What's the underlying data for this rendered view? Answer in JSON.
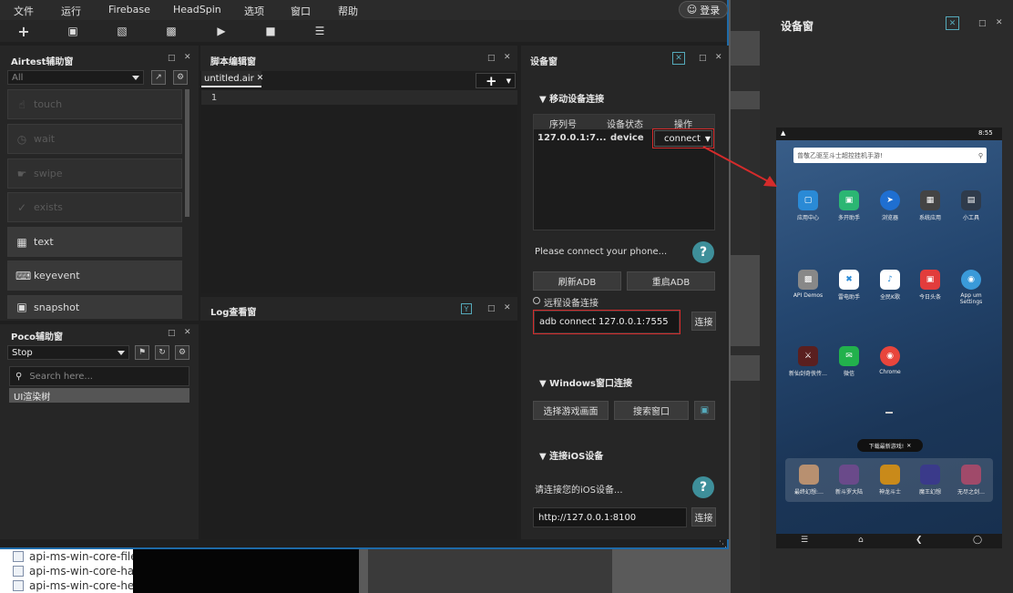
{
  "background": {
    "files": [
      "api-ms-win-core-file",
      "api-ms-win-core-ha",
      "api-ms-win-core-he"
    ]
  },
  "menubar": {
    "items": [
      "文件",
      "运行",
      "Firebase",
      "HeadSpin",
      "选项",
      "窗口",
      "帮助"
    ],
    "login_label": "登录"
  },
  "airtest": {
    "title": "Airtest辅助窗",
    "filter_value": "All",
    "actions": [
      "touch",
      "wait",
      "swipe",
      "exists",
      "text",
      "keyevent",
      "snapshot"
    ]
  },
  "poco": {
    "title": "Poco辅助窗",
    "mode_value": "Stop",
    "search_placeholder": "Search here...",
    "tree_label": "UI渲染树"
  },
  "editor": {
    "title": "脚本编辑窗",
    "tab_label": "untitled.air",
    "line_number": "1",
    "add_label": "+"
  },
  "log": {
    "title": "Log查看窗"
  },
  "device_panel": {
    "title": "设备窗",
    "mobile_section": "▼ 移动设备连接",
    "table_headers": [
      "序列号",
      "设备状态",
      "操作"
    ],
    "device": {
      "serial": "127.0.0.1:7...",
      "status": "device",
      "action": "connect"
    },
    "hint": "Please connect your phone...",
    "refresh_adb": "刷新ADB",
    "restart_adb": "重启ADB",
    "remote_label": "远程设备连接",
    "remote_value": "adb connect 127.0.0.1:7555",
    "connect_label": "连接",
    "windows_section": "▼ Windows窗口连接",
    "select_game": "选择游戏画面",
    "search_window": "搜索窗口",
    "ios_section": "▼ 连接iOS设备",
    "ios_hint": "请连接您的iOS设备...",
    "ios_url": "http://127.0.0.1:8100",
    "ios_connect_label": "连接",
    "help_label": "?"
  },
  "phone_window": {
    "title": "设备窗",
    "time": "8:55",
    "search_placeholder": "曾敬乙驱至斗士超控挂机手游!",
    "apps": [
      {
        "label": "应用中心",
        "icon": "app-center-icon",
        "color": "#2a8ad6"
      },
      {
        "label": "多开助手",
        "icon": "multi-open-icon",
        "color": "#2bb673"
      },
      {
        "label": "浏览器",
        "icon": "browser-icon",
        "color": "#1f6fd1"
      },
      {
        "label": "系统应用",
        "icon": "system-apps-icon",
        "color": "#444444"
      },
      {
        "label": "小工具",
        "icon": "tools-icon",
        "color": "#2f3b4b"
      },
      {
        "label": "API Demos",
        "icon": "api-demos-icon",
        "color": "#888888"
      },
      {
        "label": "雷电助手",
        "icon": "assistant-icon",
        "color": "#ffffff"
      },
      {
        "label": "全民K歌",
        "icon": "karaoke-icon",
        "color": "#ffffff"
      },
      {
        "label": "今日头条",
        "icon": "toutiao-icon",
        "color": "#e23c3c"
      },
      {
        "label": "App um Settings",
        "icon": "settings-app-icon",
        "color": "#3a9ad9"
      },
      {
        "label": "新仙剑奇侠传…",
        "icon": "game-icon",
        "color": "#5a1f1f"
      },
      {
        "label": "微信",
        "icon": "wechat-icon",
        "color": "#22b14c"
      },
      {
        "label": "Chrome",
        "icon": "chrome-icon",
        "color": "#e8453c"
      }
    ],
    "toast": "下载最新游戏!",
    "dock": [
      {
        "label": "最终幻想:…",
        "color": "#b89070"
      },
      {
        "label": "新斗罗大陆",
        "color": "#6a4a8a"
      },
      {
        "label": "神龙斗士",
        "color": "#c98a1a"
      },
      {
        "label": "魔王幻想",
        "color": "#3a3a8a"
      },
      {
        "label": "无尽之剑…",
        "color": "#a04a6a"
      }
    ],
    "accent": "#1e6aa8",
    "highlight": "#d52b2b"
  }
}
